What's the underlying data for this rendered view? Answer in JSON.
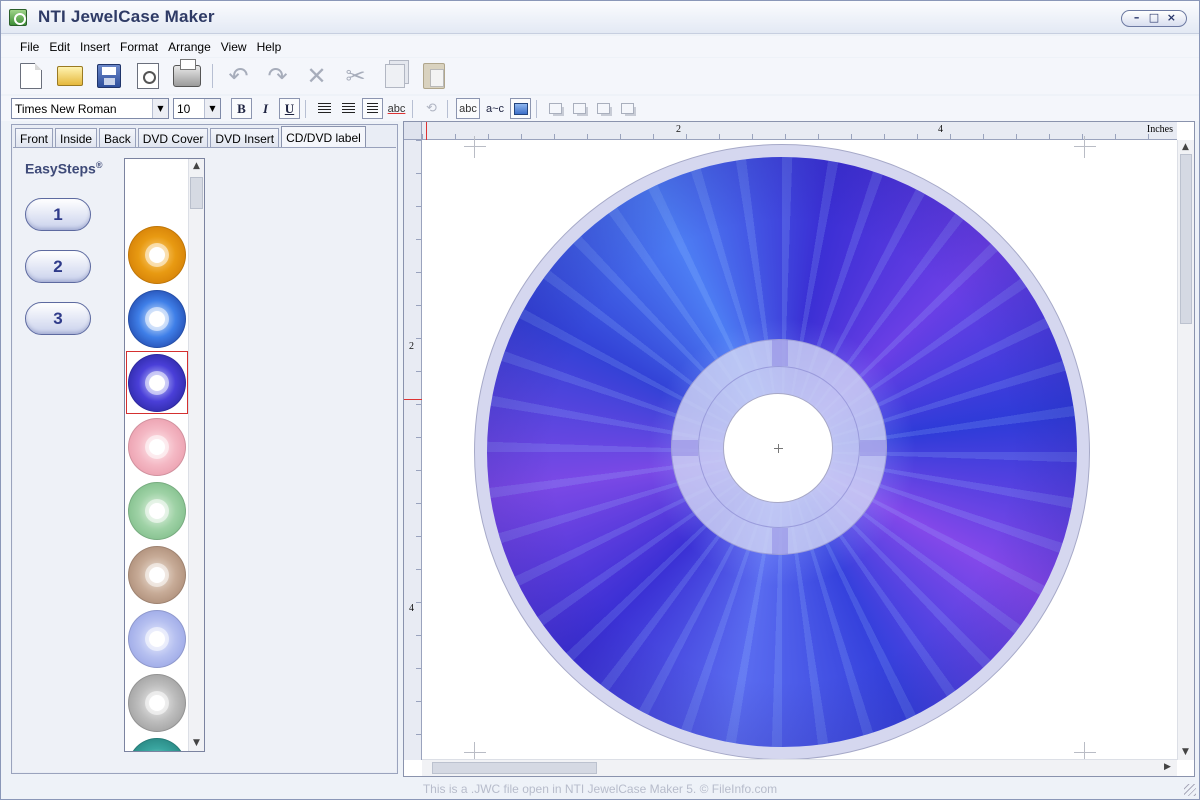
{
  "window": {
    "title": "NTI JewelCase Maker"
  },
  "menu": [
    "File",
    "Edit",
    "Insert",
    "Format",
    "Arrange",
    "View",
    "Help"
  ],
  "format": {
    "font": "Times New Roman",
    "size": "10",
    "bold": "B",
    "italic": "I",
    "underline": "U",
    "abc": "abc"
  },
  "panel": {
    "tabs": [
      "Front",
      "Inside",
      "Back",
      "DVD Cover",
      "DVD Insert",
      "CD/DVD label"
    ],
    "active_tab": "CD/DVD label",
    "easysteps_label": "EasySteps",
    "easysteps_mark": "®",
    "steps": [
      "1",
      "2",
      "3"
    ],
    "thumbnails": [
      {
        "name": "orange-disc",
        "colors": [
          "#ffd88a",
          "#e89a12",
          "#c86f00"
        ]
      },
      {
        "name": "blue-burst-disc",
        "colors": [
          "#e8f4ff",
          "#3f7fe8",
          "#122c8c"
        ]
      },
      {
        "name": "purple-plasma-disc",
        "colors": [
          "#cfd8ff",
          "#4a3fd8",
          "#1c1c88"
        ],
        "selected": true
      },
      {
        "name": "pink-disc",
        "colors": [
          "#fff0f3",
          "#f4b8c4",
          "#e58ea0"
        ]
      },
      {
        "name": "green-disc",
        "colors": [
          "#eef8ee",
          "#9fd2a6",
          "#6eb27a"
        ]
      },
      {
        "name": "brown-marble-disc",
        "colors": [
          "#f3ebe3",
          "#c7ab97",
          "#9c7a64"
        ]
      },
      {
        "name": "lavender-disc",
        "colors": [
          "#eef1ff",
          "#b6c0f0",
          "#8b98e0"
        ]
      },
      {
        "name": "gray-disc",
        "colors": [
          "#f2f2f2",
          "#bdbdbd",
          "#8e8e8e"
        ]
      },
      {
        "name": "teal-disc",
        "colors": [
          "#c9ecea",
          "#3aa6a0",
          "#1b6f6c"
        ]
      }
    ]
  },
  "canvas": {
    "ruler_units": "Inches",
    "ruler_top_labels": [
      "2",
      "4"
    ],
    "ruler_left_labels": [
      "2",
      "4"
    ]
  },
  "status": {
    "text": "This is a .JWC file open in NTI JewelCase Maker 5. © FileInfo.com"
  },
  "colors": {
    "title": "#2f3b66",
    "accent": "#4a3fd8",
    "selection": "#d43030"
  }
}
